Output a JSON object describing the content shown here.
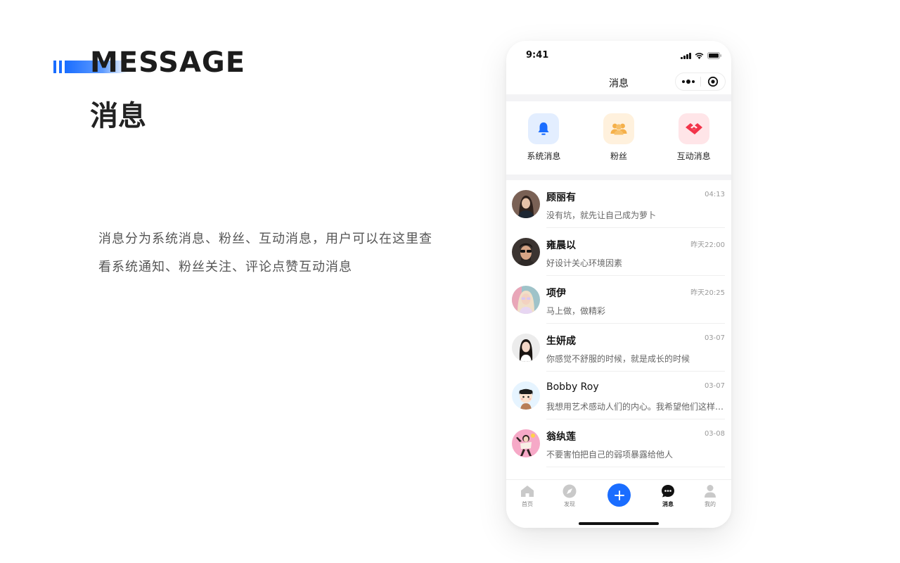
{
  "left_panel": {
    "title_en": "MESSAGE",
    "title_cn": "消息",
    "description": "消息分为系统消息、粉丝、互动消息，用户可以在这里查看系统通知、粉丝关注、评论点赞互动消息"
  },
  "phone": {
    "status_bar": {
      "time": "9:41"
    },
    "nav": {
      "title": "消息",
      "capsule_icons": [
        "more-dots-icon",
        "target-icon"
      ]
    },
    "categories": [
      {
        "label": "系统消息",
        "icon": "bell-icon",
        "bg": "#e3eeff",
        "color": "#1a6dff"
      },
      {
        "label": "粉丝",
        "icon": "fans-icon",
        "bg": "#fff1dd",
        "color": "#f5b04a"
      },
      {
        "label": "互动消息",
        "icon": "handshake-icon",
        "bg": "#ffe5e8",
        "color": "#f2344a"
      }
    ],
    "messages": [
      {
        "name": "顾丽有",
        "time": "04:13",
        "preview": "没有坑，就先让自己成为萝卜"
      },
      {
        "name": "雍晨以",
        "time": "昨天22:00",
        "preview": "好设计关心环境因素"
      },
      {
        "name": "项伊",
        "time": "昨天20:25",
        "preview": "马上做，做精彩"
      },
      {
        "name": "生妍成",
        "time": "03-07",
        "preview": "你感觉不舒服的时候，就是成长的时候"
      },
      {
        "name": "Bobby Roy",
        "time": "03-07",
        "preview": "我想用艺术感动人们的内心。我希望他们这样说…"
      },
      {
        "name": "翁纨莲",
        "time": "03-08",
        "preview": "不要害怕把自己的弱项暴露给他人"
      }
    ],
    "tab_bar": {
      "tabs": [
        {
          "label": "首页",
          "icon": "home-icon",
          "active": false
        },
        {
          "label": "发现",
          "icon": "compass-icon",
          "active": false
        },
        {
          "label": "消息",
          "icon": "chat-icon",
          "active": true
        },
        {
          "label": "我的",
          "icon": "user-icon",
          "active": false
        }
      ],
      "add_icon": "plus-icon"
    }
  },
  "colors": {
    "accent": "#1a6dff",
    "text_primary": "#111111",
    "text_secondary": "#666666"
  }
}
